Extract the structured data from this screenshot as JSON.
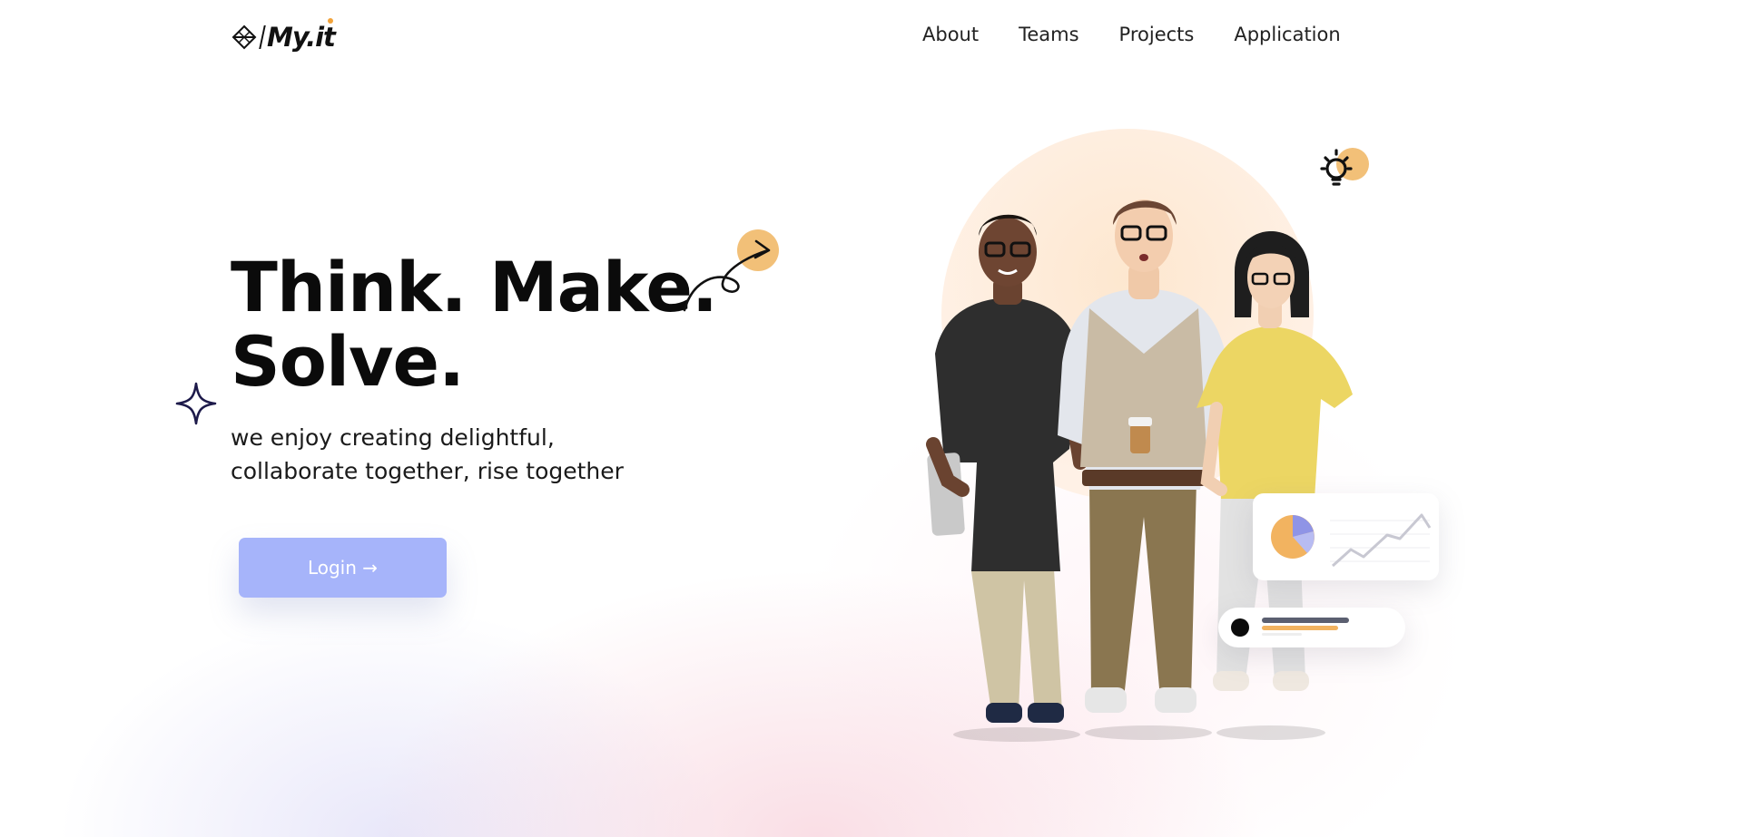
{
  "logo": {
    "text": "My.it"
  },
  "nav": {
    "items": [
      "About",
      "Teams",
      "Projects",
      "Application"
    ]
  },
  "hero": {
    "headline_line1": "Think. Make.",
    "headline_line2": "Solve.",
    "subtitle_line1": "we enjoy creating delightful,",
    "subtitle_line2": "collaborate together, rise together",
    "login_label": "Login →"
  },
  "colors": {
    "accent": "#a6b4fa",
    "orange": "#f2c078",
    "dark": "#0b0b0b"
  },
  "icons": [
    "logo-icon",
    "sparkle-icon",
    "arrow-doodle-icon",
    "lightbulb-icon",
    "pie-chart-icon",
    "line-chart-icon"
  ]
}
